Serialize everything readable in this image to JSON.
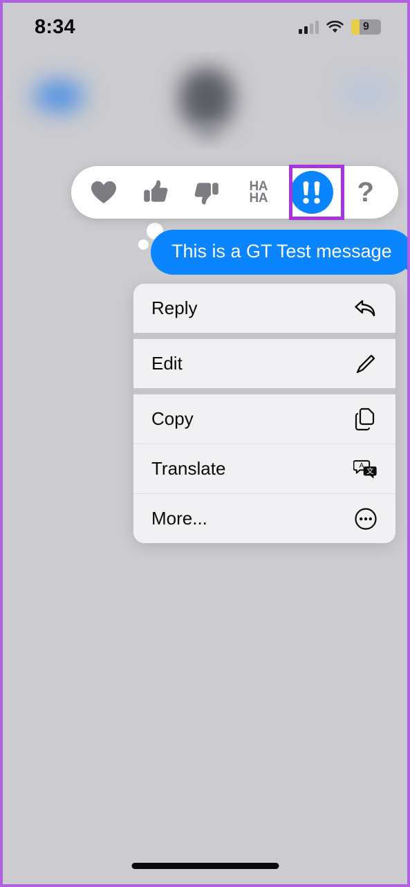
{
  "status_bar": {
    "time": "8:34",
    "signal_icon": "cellular-signal-icon",
    "signal_bars_active": 2,
    "signal_bars_total": 4,
    "wifi_icon": "wifi-icon",
    "battery_icon": "battery-icon",
    "battery_level": "9",
    "battery_low_power_color": "#e8cf4a"
  },
  "header": {
    "back_icon": "back-chevron-icon",
    "avatar_icon": "contact-avatar",
    "blurred": true
  },
  "tapback_bar": {
    "reactions": [
      {
        "name": "heart",
        "icon": "heart-icon",
        "selected": false
      },
      {
        "name": "thumbs-up",
        "icon": "thumbs-up-icon",
        "selected": false
      },
      {
        "name": "thumbs-down",
        "icon": "thumbs-down-icon",
        "selected": false
      },
      {
        "name": "haha",
        "icon": "haha-text-icon",
        "label_top": "HA",
        "label_bottom": "HA",
        "selected": false
      },
      {
        "name": "exclamation",
        "icon": "double-exclamation-icon",
        "label": "!!",
        "selected": true
      },
      {
        "name": "question",
        "icon": "question-mark-icon",
        "label": "?",
        "selected": false
      }
    ],
    "selected_color": "#0b84ff",
    "inactive_color": "#7c7c82",
    "highlight_border_color": "#a834df"
  },
  "message": {
    "text": "This is a GT Test message",
    "bubble_color": "#0b84ff",
    "text_color": "#ffffff",
    "outgoing": true
  },
  "context_menu": {
    "groups": [
      {
        "items": [
          {
            "label": "Reply",
            "icon": "reply-arrow-icon"
          }
        ]
      },
      {
        "items": [
          {
            "label": "Edit",
            "icon": "pencil-icon"
          }
        ]
      },
      {
        "items": [
          {
            "label": "Copy",
            "icon": "copy-documents-icon"
          },
          {
            "label": "Translate",
            "icon": "translate-icon"
          },
          {
            "label": "More...",
            "icon": "ellipsis-circle-icon"
          }
        ]
      }
    ]
  },
  "home_indicator": {
    "icon": "home-indicator-bar"
  }
}
